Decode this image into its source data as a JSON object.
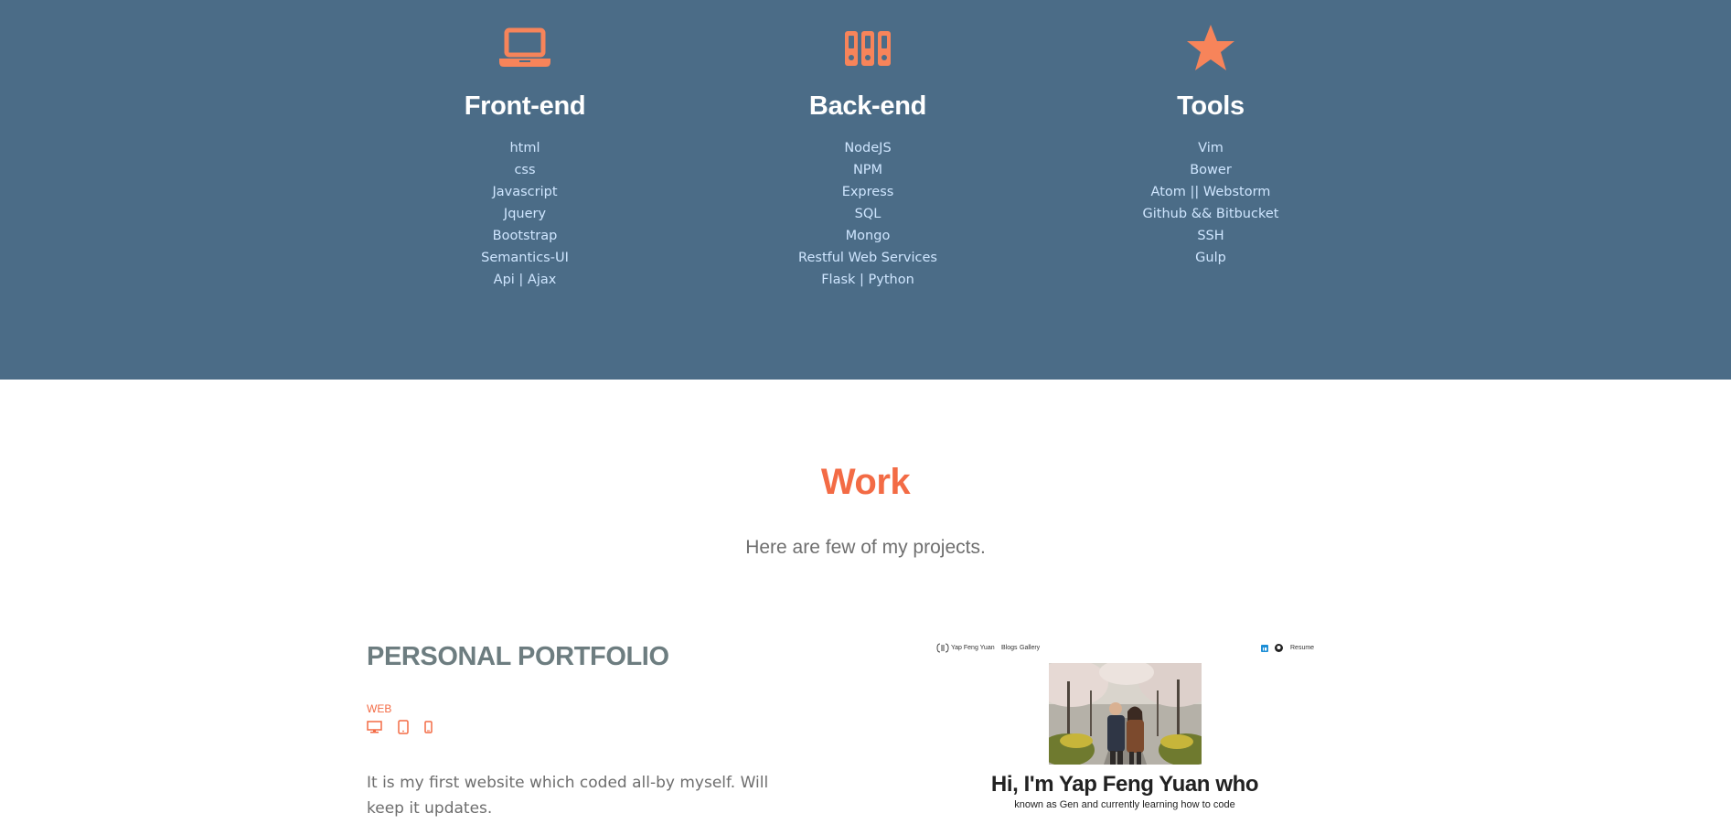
{
  "skills": {
    "columns": [
      {
        "icon": "laptop-icon",
        "title": "Front-end",
        "items": [
          "html",
          "css",
          "Javascript",
          "Jquery",
          "Bootstrap",
          "Semantics-UI",
          "Api | Ajax"
        ]
      },
      {
        "icon": "server-racks-icon",
        "title": "Back-end",
        "items": [
          "NodeJS",
          "NPM",
          "Express",
          "SQL",
          "Mongo",
          "Restful Web Services",
          "Flask | Python"
        ]
      },
      {
        "icon": "star-icon",
        "title": "Tools",
        "items": [
          "Vim",
          "Bower",
          "Atom || Webstorm",
          "Github && Bitbucket",
          "SSH",
          "Gulp"
        ]
      }
    ],
    "colors": {
      "background": "#4b6c87",
      "icon": "#f7845a",
      "title": "#ffffff",
      "item": "#cfe6ff"
    }
  },
  "work": {
    "title": "Work",
    "subtitle": "Here are few of my projects.",
    "colors": {
      "title": "#f36b45",
      "subtitle": "#6f6f6f"
    }
  },
  "project": {
    "title": "PERSONAL PORTFOLIO",
    "category": "WEB",
    "device_icons": [
      "desktop-icon",
      "tablet-icon",
      "mobile-icon"
    ],
    "description": "It is my first website which coded all-by myself. Will keep it updates.",
    "preview": {
      "logo_text": "Yap Feng Yuan",
      "nav_links": [
        "Blogs",
        "Gallery"
      ],
      "right_link": "Resume",
      "right_icons": [
        "linkedin-icon",
        "github-icon"
      ],
      "heading": "Hi, I'm Yap Feng Yuan who",
      "subheading": "known as Gen and currently learning how to code"
    }
  }
}
